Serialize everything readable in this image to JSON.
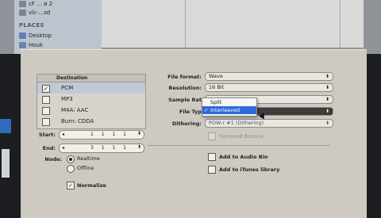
{
  "finder": {
    "devices": [
      {
        "label": "ᴄF ... ᴎ 2",
        "icon": "disk-icon"
      },
      {
        "label": "vlc-...sd",
        "icon": "disk-icon"
      }
    ],
    "places_header": "PLACES",
    "places": [
      {
        "label": "Desktop",
        "icon": "desktop-icon"
      },
      {
        "label": "Houk",
        "icon": "home-icon"
      }
    ]
  },
  "dialog": {
    "destination_header": "Destination",
    "destinations": [
      {
        "label": "PCM",
        "checked": true
      },
      {
        "label": "MP3",
        "checked": false
      },
      {
        "label": "M4A: AAC",
        "checked": false
      },
      {
        "label": "Burn: CDDA",
        "checked": false
      }
    ],
    "start_label": "Start:",
    "start_value": "1 1 1 1",
    "end_label": "End:",
    "end_value": "3 1 1 1",
    "node_label": "Node:",
    "mode_realtime": "Realtime",
    "mode_offline": "Offline",
    "normalize_label": "Normalize",
    "file_format_label": "File format:",
    "file_format_value": "Wave",
    "resolution_label": "Resolution:",
    "resolution_value": "16 Bit",
    "sample_rate_label": "Sample Rat",
    "file_type_label": "File Typ",
    "dithering_label": "Dithering:",
    "dithering_value": "POW-r #1 (Dithering)",
    "surround_label": "Surround Bounce",
    "add_audio_bin": "Add to Audio Bin",
    "add_itunes": "Add to iTunes library",
    "menu": [
      {
        "label": "Split",
        "selected": false
      },
      {
        "label": "Interleaved",
        "selected": true
      }
    ]
  },
  "colors": {
    "highlight": "#2f6bd8",
    "dialog_bg": "#cfcac1"
  }
}
